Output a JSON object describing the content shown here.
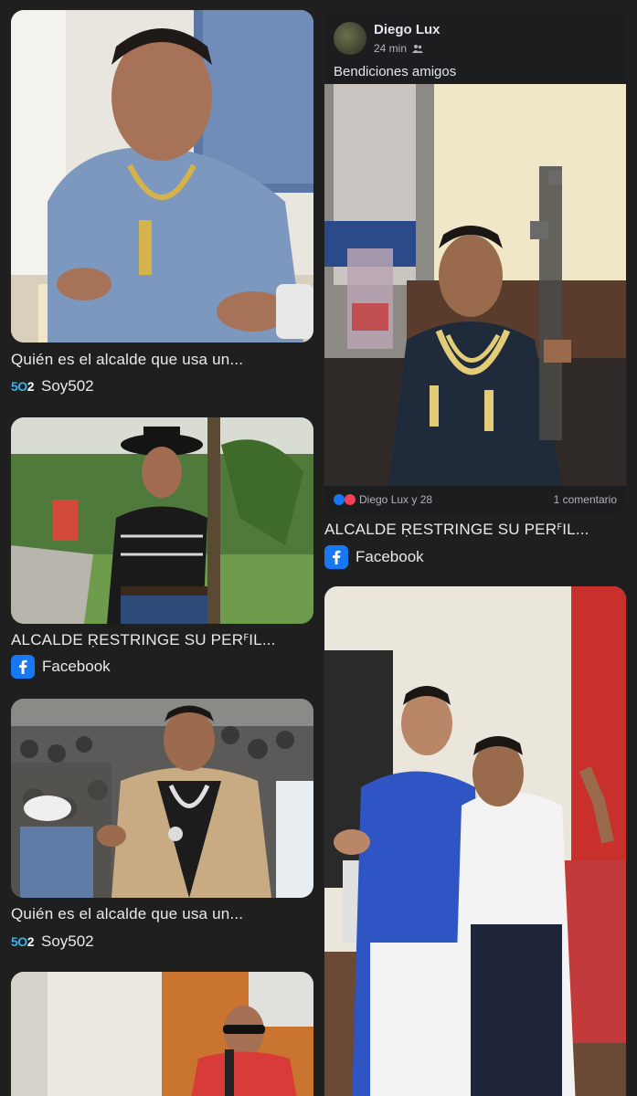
{
  "results": {
    "left": [
      {
        "title": "Quién es el alcalde que usa un...",
        "source": "Soy502",
        "source_icon": "soy502-logo-icon",
        "source_logo_text_a": "5O",
        "source_logo_text_b": "2"
      },
      {
        "title": "ALCALDE ṚESTRINGE SU PERꟳIL...",
        "source": "Facebook",
        "source_icon": "facebook-icon"
      },
      {
        "title": "Quién es el alcalde que usa un...",
        "source": "Soy502",
        "source_icon": "soy502-logo-icon",
        "source_logo_text_a": "5O",
        "source_logo_text_b": "2"
      },
      {
        "source_icon": "none"
      }
    ],
    "right": [
      {
        "title": "ALCALDE ṚESTRINGE SU PERꟳIL...",
        "source": "Facebook",
        "source_icon": "facebook-icon",
        "post": {
          "author": "Diego Lux",
          "time": "24 min",
          "audience_icon": "friends-icon",
          "caption": "Bendiciones amigos",
          "reactions": "Diego Lux y 28",
          "comments": "1 comentario"
        }
      },
      {
        "source_icon": "none"
      }
    ]
  },
  "colors": {
    "background": "#1f1f1f",
    "text": "#e8eaed",
    "facebook_blue": "#1877f2",
    "soy502_blue": "#37b4e6"
  }
}
